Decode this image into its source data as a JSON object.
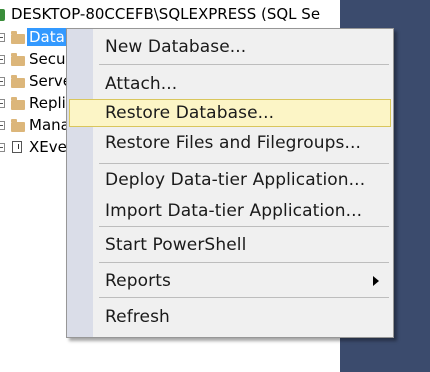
{
  "explorer": {
    "server_label": "DESKTOP-80CCEFB\\SQLEXPRESS (SQL Se",
    "nodes": [
      {
        "label": "Data"
      },
      {
        "label": "Secu"
      },
      {
        "label": "Serve"
      },
      {
        "label": "Repli"
      },
      {
        "label": "Mana"
      },
      {
        "label": "XEve"
      }
    ]
  },
  "context_menu": {
    "items": [
      {
        "label": "New Database..."
      },
      {
        "label": "Attach..."
      },
      {
        "label": "Restore Database..."
      },
      {
        "label": "Restore Files and Filegroups..."
      },
      {
        "label": "Deploy Data-tier Application..."
      },
      {
        "label": "Import Data-tier Application..."
      },
      {
        "label": "Start PowerShell"
      },
      {
        "label": "Reports"
      },
      {
        "label": "Refresh"
      }
    ],
    "highlighted": "Restore Database..."
  },
  "colors": {
    "highlight_fill": "#fcf5c6",
    "selection": "#3399ff",
    "dark_background": "#3b4b6d"
  }
}
